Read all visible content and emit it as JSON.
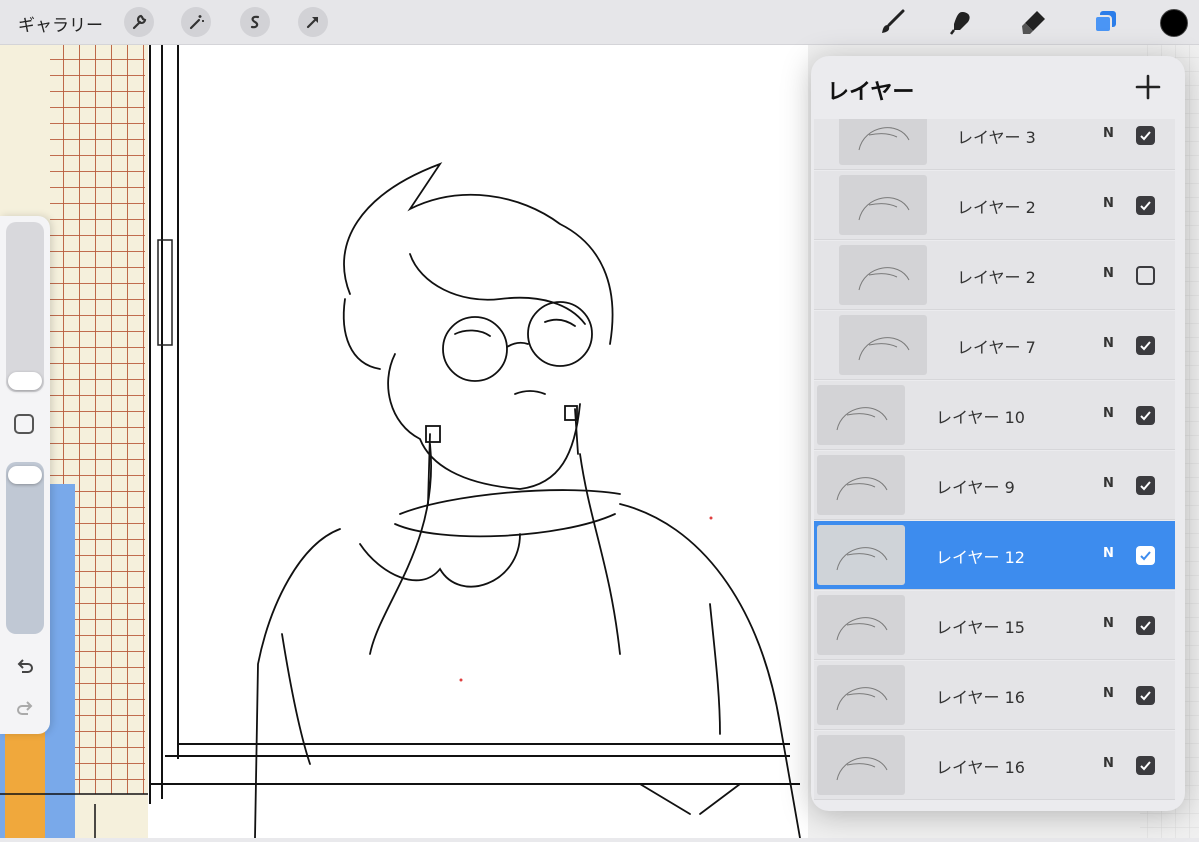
{
  "topbar": {
    "gallery_label": "ギャラリー",
    "tools_left": [
      "wrench-icon",
      "magic-wand-icon",
      "selection-icon",
      "transform-icon"
    ],
    "tools_right": [
      "brush-icon",
      "smudge-icon",
      "eraser-icon",
      "layers-icon"
    ],
    "current_color": "#000000"
  },
  "sidebar": {
    "brush_size": 0.05,
    "opacity": 1.0
  },
  "layers_panel": {
    "title": "レイヤー",
    "add_button": "+",
    "accent_color": "#3d8cee",
    "layers": [
      {
        "name": "レイヤー 3",
        "blend": "N",
        "visible": true,
        "selected": false,
        "indent": true
      },
      {
        "name": "レイヤー 2",
        "blend": "N",
        "visible": true,
        "selected": false,
        "indent": true
      },
      {
        "name": "レイヤー 2",
        "blend": "N",
        "visible": false,
        "selected": false,
        "indent": true
      },
      {
        "name": "レイヤー 7",
        "blend": "N",
        "visible": true,
        "selected": false,
        "indent": true
      },
      {
        "name": "レイヤー 10",
        "blend": "N",
        "visible": true,
        "selected": false,
        "indent": false
      },
      {
        "name": "レイヤー 9",
        "blend": "N",
        "visible": true,
        "selected": false,
        "indent": false
      },
      {
        "name": "レイヤー 12",
        "blend": "N",
        "visible": true,
        "selected": true,
        "indent": false
      },
      {
        "name": "レイヤー 15",
        "blend": "N",
        "visible": true,
        "selected": false,
        "indent": false
      },
      {
        "name": "レイヤー 16",
        "blend": "N",
        "visible": true,
        "selected": false,
        "indent": false
      },
      {
        "name": "レイヤー 16",
        "blend": "N",
        "visible": true,
        "selected": false,
        "indent": false
      }
    ]
  }
}
